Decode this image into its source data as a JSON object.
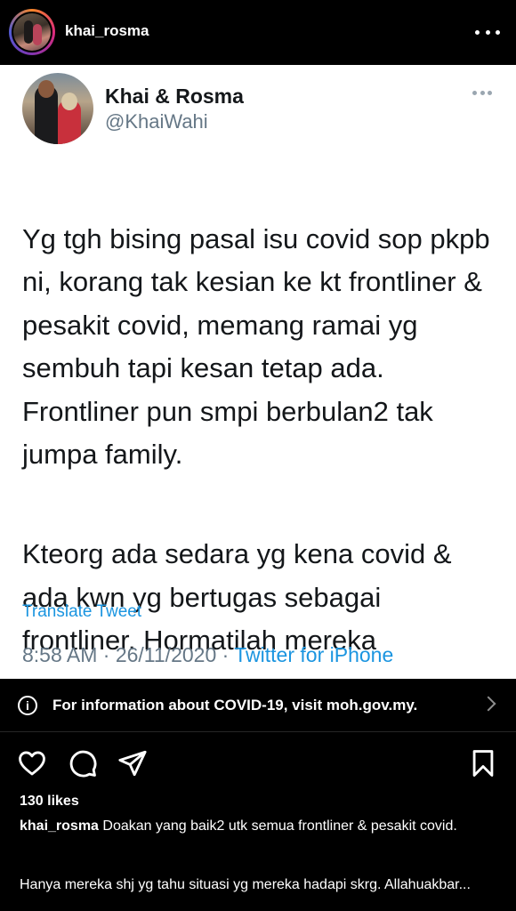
{
  "post": {
    "username": "khai_rosma"
  },
  "tweet": {
    "name": "Khai & Rosma",
    "handle": "@KhaiWahi",
    "paragraphs": [
      "Yg tgh bising pasal isu covid sop pkpb ni, korang tak kesian ke kt frontliner & pesakit covid, memang ramai yg sembuh tapi kesan tetap ada. Frontliner pun smpi berbulan2 tak jumpa family.",
      "Kteorg ada sedara yg kena covid & ada kwn yg bertugas sebagai frontliner. Hormatilah mereka"
    ],
    "translate_label": "Translate Tweet",
    "time": "8:58 AM · 26/11/2020 · ",
    "source": "Twitter for iPhone"
  },
  "info_banner": {
    "text": "For information about COVID-19, visit moh.gov.my.",
    "icon": "info-icon"
  },
  "actions": {
    "icons": [
      "heart-icon",
      "comment-icon",
      "share-icon",
      "bookmark-icon"
    ]
  },
  "likes": "130 likes",
  "caption": {
    "username": "khai_rosma",
    "text": " Doakan yang baik2 utk semua frontliner & pesakit covid.",
    "text2": "Hanya mereka shj yg tahu situasi yg mereka hadapi skrg. Allahuakbar..."
  },
  "colors": {
    "twitter_blue": "#1b95e0",
    "muted_gray": "#657786",
    "background": "#000000"
  }
}
